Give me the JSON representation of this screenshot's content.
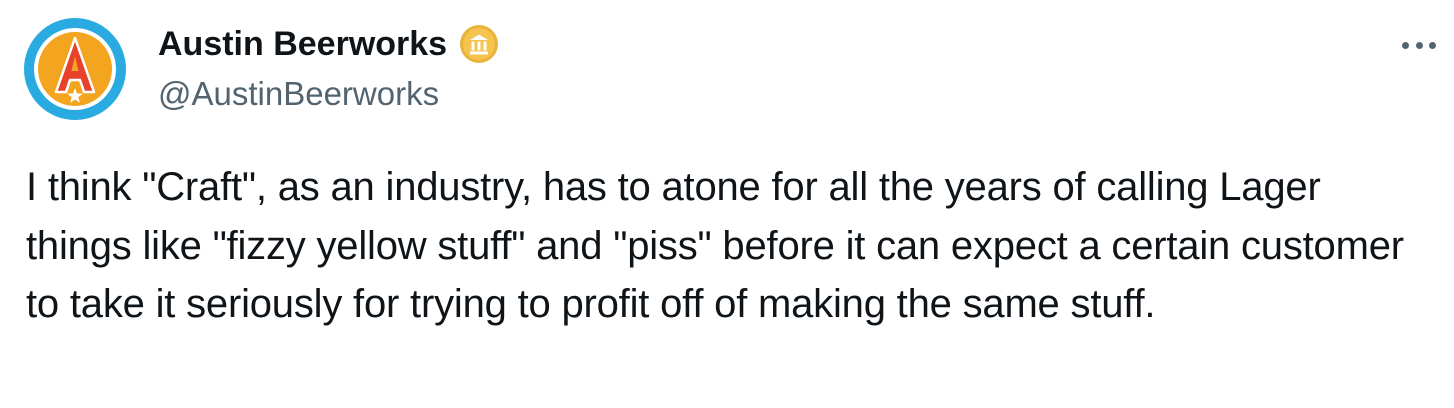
{
  "author": {
    "display_name": "Austin Beerworks",
    "handle": "@AustinBeerworks",
    "avatar_icon": "austin-beerworks-logo",
    "badge_icon": "gold-verified-organization-badge"
  },
  "more_menu_icon": "ellipsis-icon",
  "tweet": {
    "text": "I think \"Craft\", as an industry, has to atone for all the years of calling Lager things like \"fizzy yellow stuff\" and \"piss\" before it can expect a certain customer to take it seriously for trying to profit off of making the same stuff."
  },
  "colors": {
    "text_primary": "#0f1419",
    "text_secondary": "#536471",
    "avatar_ring": "#29abe2",
    "avatar_letter": "#e8412c",
    "badge_gold": "#e8b339"
  }
}
